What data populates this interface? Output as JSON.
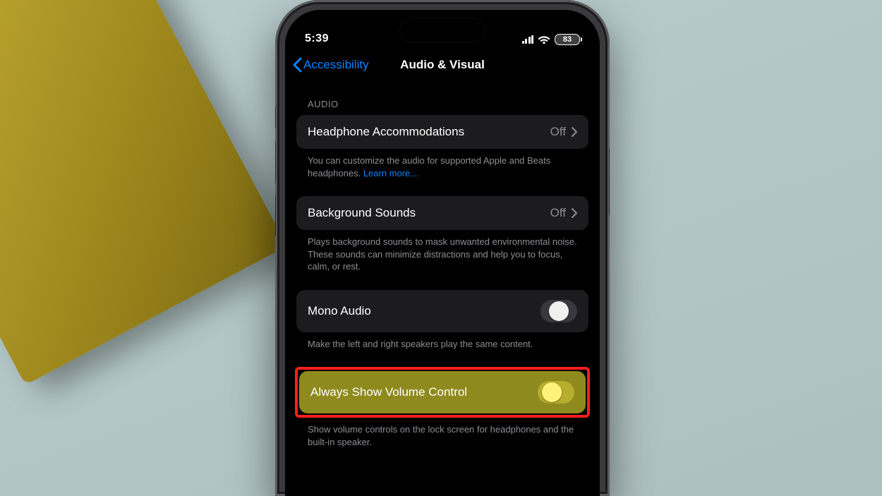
{
  "status": {
    "time": "5:39",
    "battery": "83"
  },
  "nav": {
    "back_label": "Accessibility",
    "title": "Audio & Visual"
  },
  "audio": {
    "section_label": "AUDIO",
    "headphone": {
      "title": "Headphone Accommodations",
      "value": "Off",
      "footer": "You can customize the audio for supported Apple and Beats headphones.",
      "learn_more": "Learn more…"
    },
    "background_sounds": {
      "title": "Background Sounds",
      "value": "Off",
      "footer": "Plays background sounds to mask unwanted environmental noise. These sounds can minimize distractions and help you to focus, calm, or rest."
    },
    "mono_audio": {
      "title": "Mono Audio",
      "footer": "Make the left and right speakers play the same content."
    },
    "always_volume": {
      "title": "Always Show Volume Control",
      "footer": "Show volume controls on the lock screen for headphones and the built-in speaker."
    }
  }
}
